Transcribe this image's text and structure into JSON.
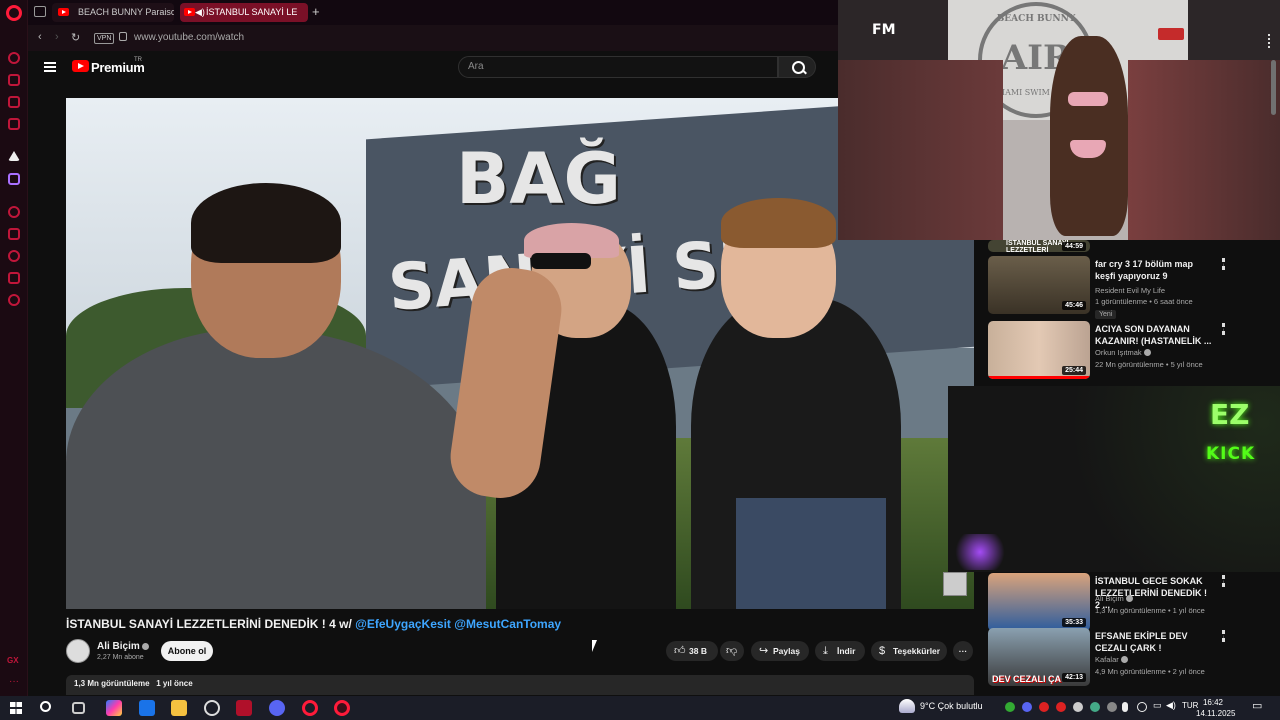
{
  "browser": {
    "tabs": [
      {
        "label": "BEACH BUNNY Paraiso Sw"
      },
      {
        "label": "İSTANBUL SANAYİ LE"
      }
    ],
    "url": "www.youtube.com/watch",
    "vpn_label": "VPN"
  },
  "youtube": {
    "logo_text": "Premium",
    "region": "TR",
    "search_placeholder": "Ara"
  },
  "video": {
    "title": "İSTANBUL SANAYİ LEZZETLERİNİ DENEDİK ! 4 w/",
    "mentions": [
      "@EfeUygaçKesit",
      "@MesutCanTomay"
    ],
    "sign_line1": "BAĞ",
    "sign_line2": "SANAYİ SİT",
    "channel": "Ali Biçim",
    "subscribers": "2,27 Mn abone",
    "subscribe_label": "Abone ol",
    "likes": "38 B",
    "share_label": "Paylaş",
    "download_label": "İndir",
    "thanks_label": "Teşekkürler",
    "views": "1,3 Mn görüntüleme",
    "age": "1 yıl önce"
  },
  "pip": {
    "seal_top": "BEACH BUNNY",
    "seal_main": "AIR",
    "seal_bottom": "MIAMI SWIM WEEK",
    "corner_logo": "FM"
  },
  "recommendations": [
    {
      "title": "İSTANBUL SANAYİ LEZZETLERİ",
      "duration": "44:59"
    },
    {
      "title": "far cry 3 17 bölüm map keşfi yapıyoruz 9",
      "channel": "Resident Evil My Life",
      "meta": "1 görüntülenme • 6 saat önce",
      "duration": "45:46",
      "badge": "Yeni"
    },
    {
      "title": "ACIYA SON DAYANAN KAZANIR! (HASTANELİK ...",
      "channel": "Orkun Işıtmak",
      "meta": "22 Mn görüntülenme • 5 yıl önce",
      "duration": "25:44"
    },
    {
      "title": "İSTANBUL GECE SOKAK LEZZETLERİNİ DENEDİK ! 2 ...",
      "channel": "Ali Biçim",
      "meta": "1,3 Mn görüntülenme • 1 yıl önce",
      "duration": "35:33"
    },
    {
      "title": "EFSANE EKİPLE DEV CEZALI ÇARK !",
      "channel": "Kafalar",
      "meta": "4,9 Mn görüntülenme • 2 yıl önce",
      "duration": "42:13",
      "thumb_text": "DEV CEZALI ÇA"
    }
  ],
  "kick_overlay": {
    "line1": "EZ",
    "line2": "KICK"
  },
  "sidebar_gx": "GX",
  "taskbar": {
    "weather": "9°C  Çok bulutlu",
    "lang": "TUR",
    "time": "16:42",
    "date": "14.11.2025"
  }
}
